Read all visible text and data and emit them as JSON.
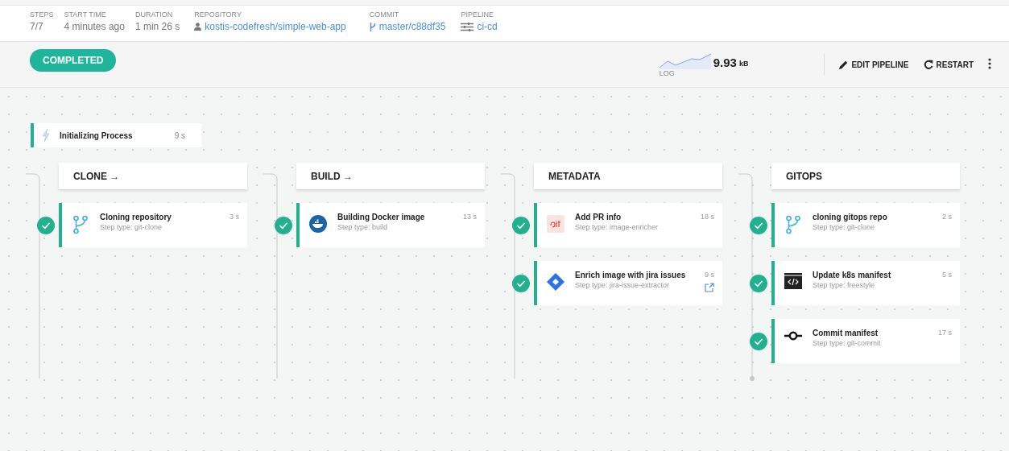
{
  "summary": [
    {
      "label": "STEPS",
      "value": "7/7",
      "kind": "plain"
    },
    {
      "label": "START TIME",
      "value": "4 minutes ago",
      "kind": "plain"
    },
    {
      "label": "DURATION",
      "value": "1 min 26 s",
      "kind": "plain"
    },
    {
      "label": "REPOSITORY",
      "value": "kostis-codefresh/simple-web-app",
      "kind": "repo"
    },
    {
      "label": "COMMIT",
      "value": "master/c88df35",
      "kind": "commit"
    },
    {
      "label": "PIPELINE",
      "value": "ci-cd",
      "kind": "pipeline"
    }
  ],
  "status": "COMPLETED",
  "log": {
    "size": "9.93",
    "unit": "kB",
    "label": "LOG"
  },
  "actions": [
    {
      "label": "EDIT PIPELINE",
      "kind": "edit"
    },
    {
      "label": "RESTART",
      "kind": "restart"
    }
  ],
  "init": {
    "title": "Initializing Process",
    "duration": "9 s"
  },
  "stages": [
    {
      "title": "CLONE →",
      "end_marker": false,
      "steps": [
        {
          "title": "Cloning repository",
          "type": "Step type: git-clone",
          "duration": "3 s",
          "kind": "git-clone",
          "done": true,
          "external_link": false
        }
      ]
    },
    {
      "title": "BUILD →",
      "end_marker": false,
      "steps": [
        {
          "title": "Building Docker image",
          "type": "Step type: build",
          "duration": "13 s",
          "kind": "build",
          "done": true,
          "external_link": false
        }
      ]
    },
    {
      "title": "METADATA",
      "end_marker": false,
      "steps": [
        {
          "title": "Add PR info",
          "type": "Step type: image-enricher",
          "duration": "18 s",
          "kind": "git",
          "done": true,
          "external_link": false
        },
        {
          "title": "Enrich image with jira issues",
          "type": "Step type: jira-issue-extractor",
          "duration": "9 s",
          "kind": "jira",
          "done": true,
          "external_link": true
        }
      ]
    },
    {
      "title": "GITOPS",
      "end_marker": true,
      "steps": [
        {
          "title": "cloning gitops repo",
          "type": "Step type: git-clone",
          "duration": "2 s",
          "kind": "git-clone",
          "done": true,
          "external_link": false
        },
        {
          "title": "Update k8s manifest",
          "type": "Step type: freestyle",
          "duration": "5 s",
          "kind": "freestyle",
          "done": true,
          "external_link": false
        },
        {
          "title": "Commit manifest",
          "type": "Step type: git-commit",
          "duration": "17 s",
          "kind": "commit",
          "done": true,
          "external_link": false
        }
      ]
    }
  ]
}
